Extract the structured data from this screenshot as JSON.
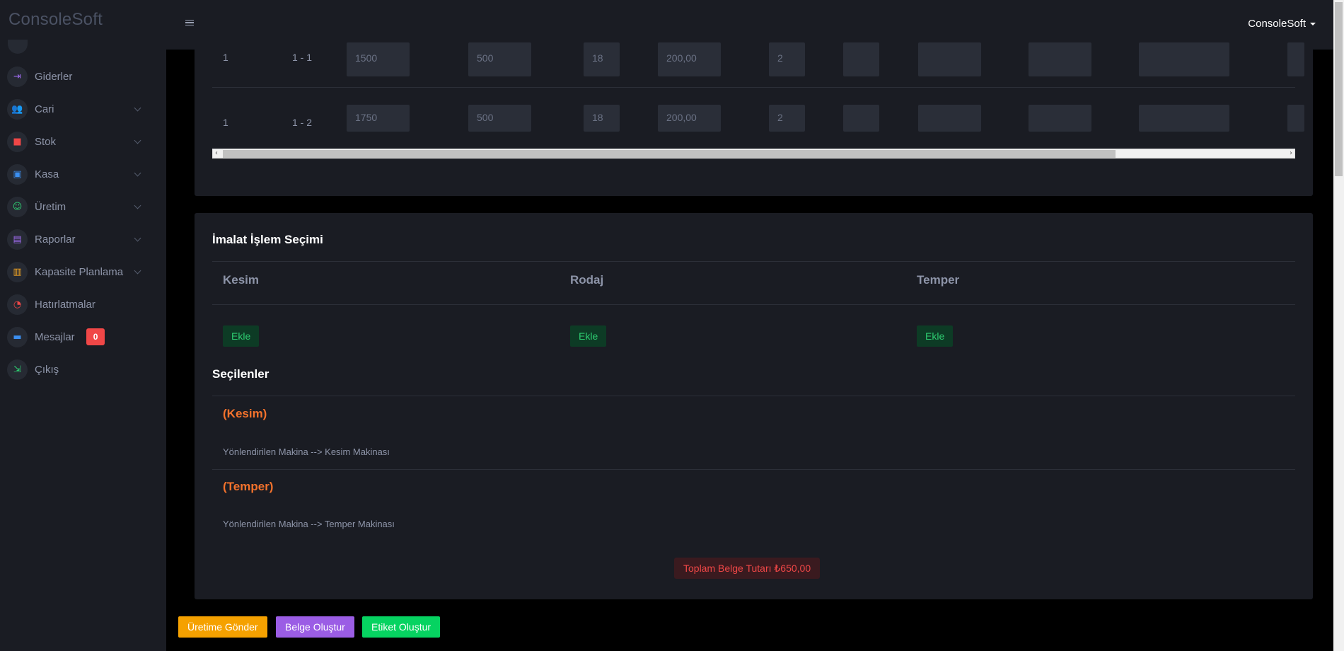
{
  "brand": "ConsoleSoft",
  "sidebar": {
    "items": [
      {
        "label": "Giderler",
        "icon": "arrow-to-right-icon",
        "color": "#a06cf0",
        "has_chevron": false
      },
      {
        "label": "Cari",
        "icon": "users-icon",
        "color": "#f5a623",
        "has_chevron": true
      },
      {
        "label": "Stok",
        "icon": "cube-icon",
        "color": "#f04747",
        "has_chevron": true
      },
      {
        "label": "Kasa",
        "icon": "cash-icon",
        "color": "#3b8ff0",
        "has_chevron": true
      },
      {
        "label": "Üretim",
        "icon": "robot-icon",
        "color": "#2ecc71",
        "has_chevron": true
      },
      {
        "label": "Raporlar",
        "icon": "report-icon",
        "color": "#a06cf0",
        "has_chevron": true
      },
      {
        "label": "Kapasite Planlama",
        "icon": "clipboard-icon",
        "color": "#f5a623",
        "has_chevron": true
      },
      {
        "label": "Hatırlatmalar",
        "icon": "timer-icon",
        "color": "#f04747",
        "has_chevron": false
      },
      {
        "label": "Mesajlar",
        "icon": "chat-icon",
        "color": "#3b8ff0",
        "has_chevron": false,
        "badge": "0"
      },
      {
        "label": "Çıkış",
        "icon": "logout-icon",
        "color": "#2ecc71",
        "has_chevron": false
      }
    ]
  },
  "topbar": {
    "user": "ConsoleSoft"
  },
  "table": {
    "rows": [
      {
        "sira": "1",
        "kod": "1 - 1",
        "v1": "1500",
        "v2": "500",
        "v3": "18",
        "v4": "200,00",
        "v5": "2"
      },
      {
        "sira": "1",
        "kod": "1 - 2",
        "v1": "1750",
        "v2": "500",
        "v3": "18",
        "v4": "200,00",
        "v5": "2"
      }
    ]
  },
  "imalat": {
    "title": "İmalat İşlem Seçimi",
    "columns": [
      "Kesim",
      "Rodaj",
      "Temper"
    ],
    "add_label": "Ekle"
  },
  "secilenler": {
    "title": "Seçilenler",
    "items": [
      {
        "name": "(Kesim)",
        "desc": "Yönlendirilen Makina --> Kesim Makinası"
      },
      {
        "name": "(Temper)",
        "desc": "Yönlendirilen Makina --> Temper Makinası"
      }
    ]
  },
  "total": "Toplam Belge Tutarı ₺650,00",
  "actions": {
    "uretim": {
      "label": "Üretime Gönder",
      "color": "#f5a100"
    },
    "belge": {
      "label": "Belge Oluştur",
      "color": "#9b5de5"
    },
    "etiket": {
      "label": "Etiket Oluştur",
      "color": "#06d361"
    }
  }
}
